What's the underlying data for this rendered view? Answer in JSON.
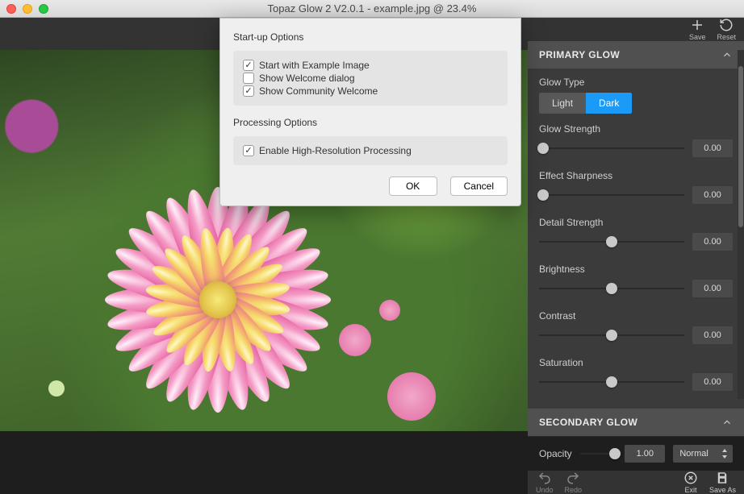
{
  "window": {
    "title": "Topaz Glow 2 V2.0.1 - example.jpg @ 23.4%"
  },
  "top_actions": {
    "save": "Save",
    "reset": "Reset"
  },
  "panels": {
    "primary_glow": {
      "title": "PRIMARY GLOW",
      "glow_type_label": "Glow Type",
      "glow_type_light": "Light",
      "glow_type_dark": "Dark",
      "sliders": [
        {
          "label": "Glow Strength",
          "value": "0.00",
          "pos": 0.03
        },
        {
          "label": "Effect Sharpness",
          "value": "0.00",
          "pos": 0.03
        },
        {
          "label": "Detail Strength",
          "value": "0.00",
          "pos": 0.5
        },
        {
          "label": "Brightness",
          "value": "0.00",
          "pos": 0.5
        },
        {
          "label": "Contrast",
          "value": "0.00",
          "pos": 0.5
        },
        {
          "label": "Saturation",
          "value": "0.00",
          "pos": 0.5
        }
      ]
    },
    "secondary_glow": {
      "title": "SECONDARY GLOW"
    }
  },
  "bottom": {
    "opacity_label": "Opacity",
    "opacity_value": "1.00",
    "opacity_pos": 0.95,
    "blend_mode": "Normal"
  },
  "footer": {
    "undo": "Undo",
    "redo": "Redo",
    "exit": "Exit",
    "save_as": "Save As"
  },
  "modal": {
    "section1_title": "Start-up Options",
    "opt_example": "Start with Example Image",
    "opt_welcome": "Show Welcome dialog",
    "opt_community": "Show Community Welcome",
    "section2_title": "Processing Options",
    "opt_hires": "Enable High-Resolution Processing",
    "ok": "OK",
    "cancel": "Cancel"
  }
}
